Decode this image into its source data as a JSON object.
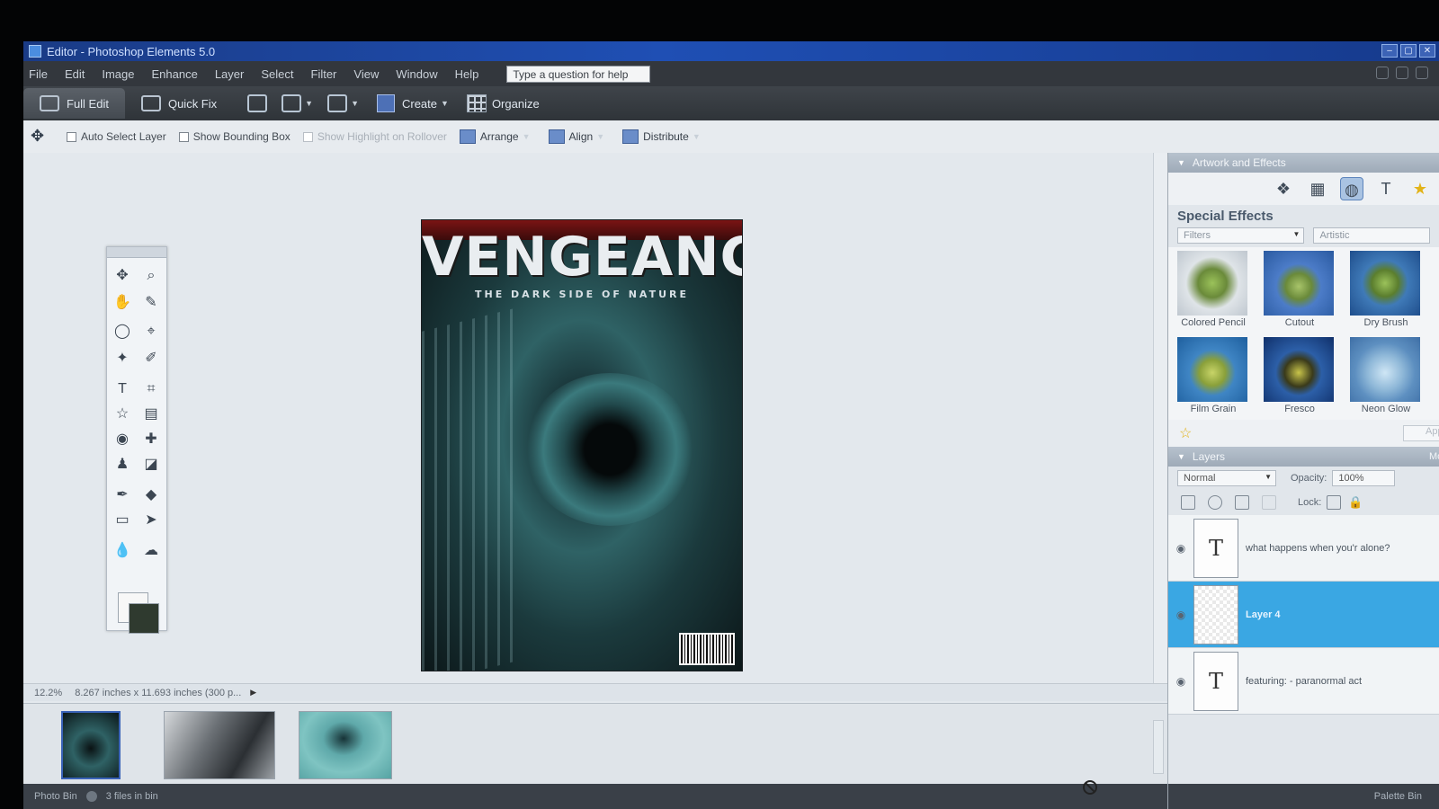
{
  "window": {
    "title": "Editor - Photoshop Elements 5.0",
    "controls": [
      "–",
      "▢",
      "✕"
    ]
  },
  "menu": {
    "items": [
      "File",
      "Edit",
      "Image",
      "Enhance",
      "Layer",
      "Select",
      "Filter",
      "View",
      "Window",
      "Help"
    ],
    "help_placeholder": "Type a question for help"
  },
  "modebar": {
    "full_edit": "Full Edit",
    "quick_fix": "Quick Fix",
    "create": "Create",
    "organize": "Organize"
  },
  "options": {
    "auto_select": "Auto Select Layer",
    "bounding_box": "Show Bounding Box",
    "highlight": "Show Highlight on Rollover",
    "arrange": "Arrange",
    "align": "Align",
    "distribute": "Distribute"
  },
  "document": {
    "headline": "VENGEANCE",
    "tagline": "THE DARK SIDE OF NATURE",
    "zoom": "12.2%",
    "size_info": "8.267 inches x 11.693 inches (300 p..."
  },
  "photobin": {
    "label": "Photo Bin",
    "count": "3 files in bin"
  },
  "effects_panel": {
    "header": "Artwork and Effects",
    "section_title": "Special Effects",
    "category": "Filters",
    "subcategory": "Artistic",
    "apply_label": "Apply",
    "effects": [
      {
        "name": "Colored Pencil",
        "color": "#7aa64a"
      },
      {
        "name": "Cutout",
        "color": "#4c7cc8"
      },
      {
        "name": "Dry Brush",
        "color": "#3f7ab8"
      },
      {
        "name": "Film Grain",
        "color": "#3f85c4"
      },
      {
        "name": "Fresco",
        "color": "#2c5fa8"
      },
      {
        "name": "Neon Glow",
        "color": "#8fb8d8"
      }
    ]
  },
  "layers_panel": {
    "header": "Layers",
    "more": "More",
    "blend_mode": "Normal",
    "opacity_label": "Opacity:",
    "opacity_value": "100%",
    "lock_label": "Lock:",
    "layers": [
      {
        "name": "what happens when you'r alone?",
        "type_glyph": "T",
        "selected": false
      },
      {
        "name": "Layer 4",
        "type_glyph": "",
        "selected": true
      },
      {
        "name": "featuring:   - paranormal act",
        "type_glyph": "T",
        "selected": false
      }
    ]
  },
  "palette_bin": {
    "label": "Palette Bin"
  },
  "colors": {
    "accent_blue": "#3aa7e3",
    "title_blue": "#1f4fb4"
  }
}
